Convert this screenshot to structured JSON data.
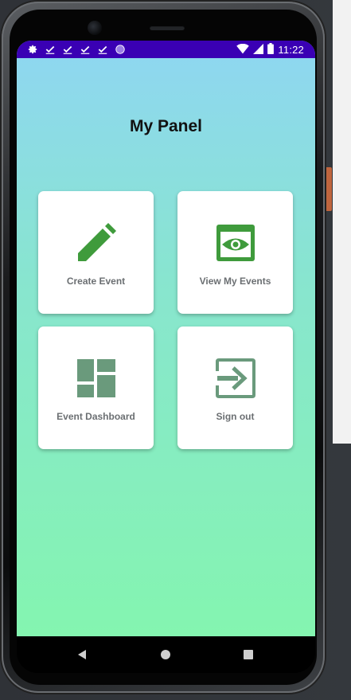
{
  "status_bar": {
    "time": "11:22",
    "left_icons": [
      "settings-icon",
      "check-icon",
      "check-icon",
      "check-icon",
      "check-icon",
      "circle-icon"
    ],
    "right_icons": [
      "wifi-icon",
      "signal-icon",
      "battery-icon"
    ],
    "background": "#3a00b4"
  },
  "screen": {
    "title": "My Panel",
    "gradient_top": "#8fd6f2",
    "gradient_bottom": "#84f5b0"
  },
  "cards": [
    {
      "label": "Create Event",
      "icon": "pencil-icon",
      "icon_color": "#3f9b3c"
    },
    {
      "label": "View My Events",
      "icon": "eye-window-icon",
      "icon_color": "#3f9b3c"
    },
    {
      "label": "Event Dashboard",
      "icon": "dashboard-icon",
      "icon_color": "#6a9a7c"
    },
    {
      "label": "Sign out",
      "icon": "sign-in-icon",
      "icon_color": "#6a9a7c"
    }
  ],
  "nav_bar": {
    "buttons": [
      "back-icon",
      "home-icon",
      "recents-icon"
    ]
  }
}
